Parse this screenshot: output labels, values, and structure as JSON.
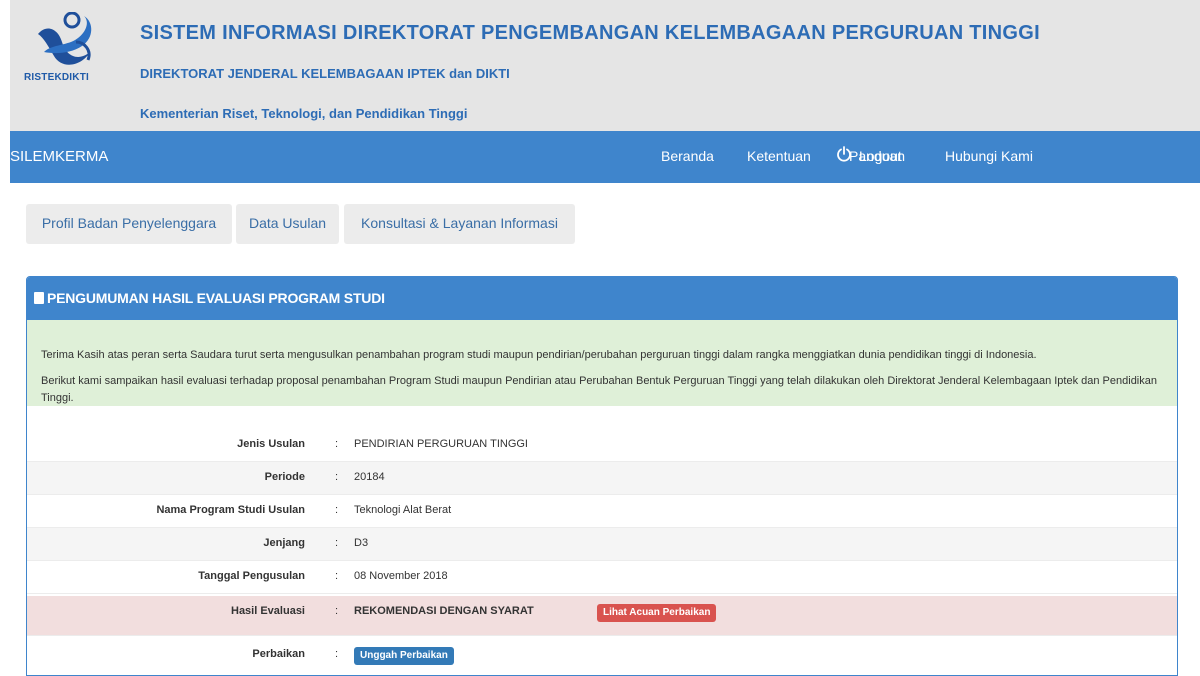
{
  "header": {
    "logo_text": "RISTEKDIKTI",
    "title": "SISTEM INFORMASI DIREKTORAT PENGEMBANGAN KELEMBAGAAN PERGURUAN TINGGI",
    "subtitle": "DIREKTORAT JENDERAL KELEMBAGAAN IPTEK dan DIKTI",
    "ministry": "Kementerian Riset, Teknologi, dan Pendidikan Tinggi"
  },
  "navbar": {
    "brand": "SILEMKERMA",
    "items": [
      "Beranda",
      "Ketentuan",
      "Panduan",
      "Hubungi Kami"
    ],
    "logout": "Logout"
  },
  "tabs": [
    "Profil Badan Penyelenggara",
    "Data Usulan",
    "Konsultasi & Layanan Informasi"
  ],
  "panel": {
    "title": "PENGUMUMAN HASIL EVALUASI PROGRAM STUDI",
    "notice_1": "Terima Kasih atas peran serta Saudara turut serta mengusulkan penambahan program studi maupun pendirian/perubahan perguruan tinggi dalam rangka menggiatkan dunia pendidikan tinggi di Indonesia.",
    "notice_2": "Berikut kami sampaikan hasil evaluasi terhadap proposal penambahan Program Studi maupun Pendirian atau Perubahan Bentuk Perguruan Tinggi yang telah dilakukan oleh Direktorat Jenderal Kelembagaan Iptek dan Pendidikan Tinggi.",
    "rows": [
      {
        "label": "Jenis Usulan",
        "value": "PENDIRIAN PERGURUAN TINGGI"
      },
      {
        "label": "Periode",
        "value": "20184"
      },
      {
        "label": "Nama Program Studi Usulan",
        "value": "Teknologi Alat Berat"
      },
      {
        "label": "Jenjang",
        "value": "D3"
      },
      {
        "label": "Tanggal Pengusulan",
        "value": "08 November 2018"
      },
      {
        "label": "Hasil Evaluasi",
        "value": "REKOMENDASI DENGAN SYARAT"
      },
      {
        "label": "Perbaikan",
        "value": ""
      }
    ],
    "colon": ":",
    "btn_acuan": "Lihat Acuan Perbaikan",
    "btn_unggah": "Unggah Perbaikan"
  },
  "colors": {
    "brand_blue": "#3f85cc",
    "header_bg": "#e5e5e5",
    "notice_bg": "#dff0d8",
    "danger_bg": "#f2dede",
    "btn_red": "#d9534f",
    "btn_blue": "#337ab7"
  }
}
